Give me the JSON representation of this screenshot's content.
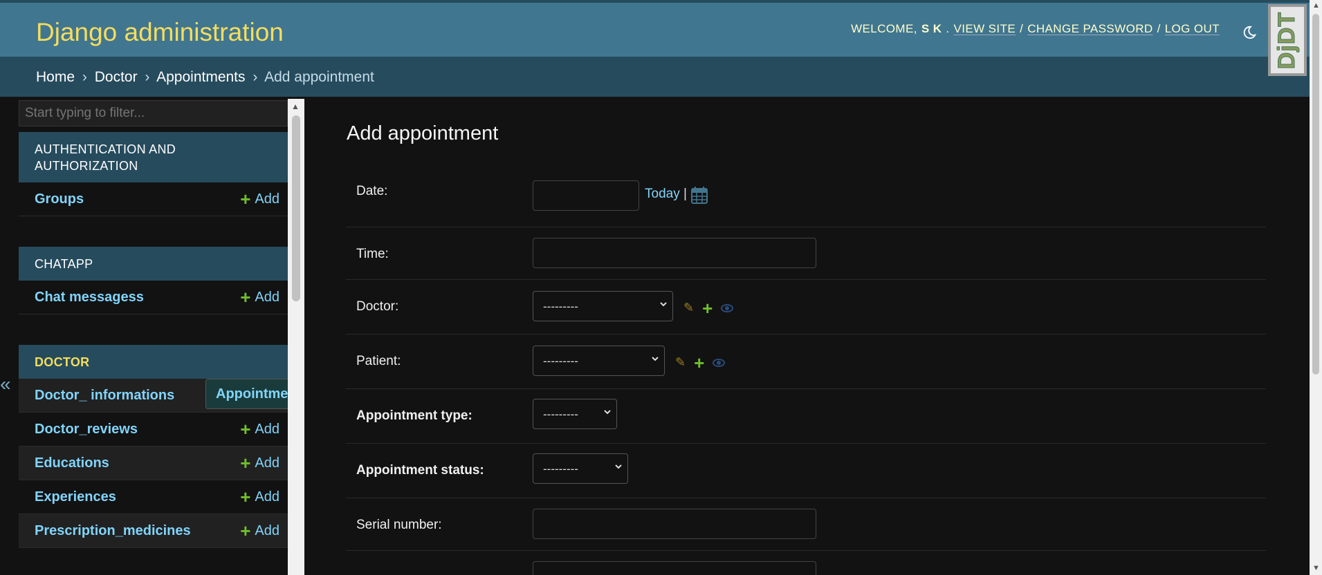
{
  "header": {
    "site_name": "Django administration",
    "welcome": "WELCOME,",
    "user": "S K",
    "view_site": "VIEW SITE",
    "change_password": "CHANGE PASSWORD",
    "log_out": "LOG OUT",
    "separator": "/",
    "theme_icon": "moon-icon",
    "debug_toolbar_label": "DjDT"
  },
  "breadcrumbs": {
    "home": "Home",
    "app": "Doctor",
    "model": "Appointments",
    "current": "Add appointment",
    "separator": "›"
  },
  "sidebar": {
    "filter_placeholder": "Start typing to filter...",
    "collapse_label": "«",
    "add_label": "Add",
    "apps": [
      {
        "name": "AUTHENTICATION AND AUTHORIZATION",
        "models": [
          "Groups"
        ]
      },
      {
        "name": "CHATAPP",
        "models": [
          "Chat messagess"
        ]
      },
      {
        "name": "DOCTOR",
        "models": [
          "Appointments",
          "Doctor_ informations",
          "Doctor_reviews",
          "Educations",
          "Experiences",
          "Prescription_medicines"
        ]
      }
    ],
    "selected_model": "Appointments"
  },
  "form": {
    "title": "Add appointment",
    "date_label": "Date:",
    "today_link": "Today",
    "today_sep": "|",
    "time_label": "Time:",
    "doctor_label": "Doctor:",
    "doctor_value": "---------",
    "patient_label": "Patient:",
    "patient_value": "---------",
    "appointment_type_label": "Appointment type:",
    "appointment_type_value": "---------",
    "appointment_status_label": "Appointment status:",
    "appointment_status_value": "---------",
    "serial_number_label": "Serial number:"
  },
  "colors": {
    "header_bg": "#417690",
    "breadcrumb_bg": "#264b5d",
    "accent_yellow": "#f5dd5d",
    "link_blue": "#81d4fa",
    "add_green": "#70bf2b",
    "page_bg": "#121212"
  }
}
